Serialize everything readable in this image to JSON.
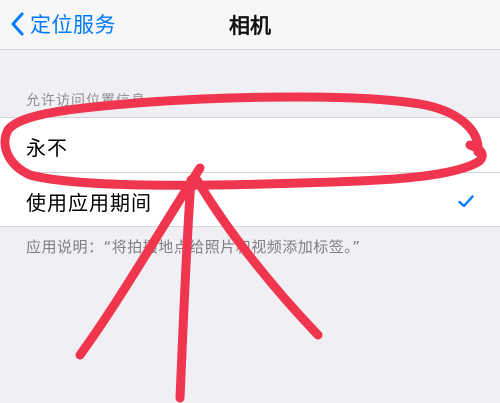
{
  "navbar": {
    "back_label": "定位服务",
    "title": "相机",
    "back_icon": "chevron-left-icon"
  },
  "section": {
    "header": "允许访问位置信息",
    "options": [
      {
        "label": "永不",
        "selected": false
      },
      {
        "label": "使用应用期间",
        "selected": true
      }
    ],
    "footer": "应用说明：“将拍摄地点给照片和视频添加标签。”"
  },
  "colors": {
    "accent": "#007aff",
    "annotation": "#f0364f",
    "background": "#efeff4"
  }
}
